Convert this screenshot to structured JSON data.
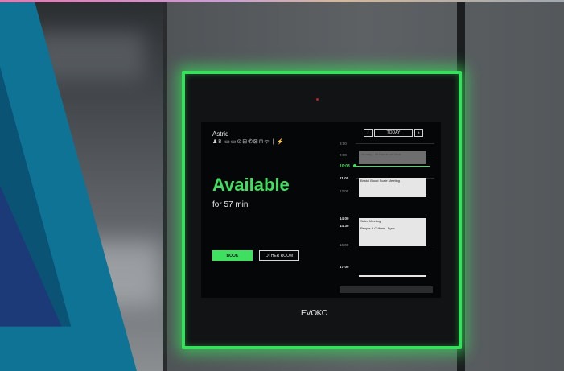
{
  "device": {
    "room_name": "Astrid",
    "facilities": "♟8 ▭▭⊙⊟✆⊠⊓ᯤ | ⚡",
    "status": "Available",
    "duration": "for 57 min",
    "book_label": "BOOK",
    "other_room_label": "OTHER ROOM",
    "brand": "EVOKO",
    "status_color": "#3fe05f",
    "frame_color": "#35e05a"
  },
  "calendar": {
    "prev_icon": "‹",
    "today_label": "TODAY",
    "next_icon": "›",
    "now_time": "10:03",
    "times": [
      "8:00",
      "9:00",
      "11:00",
      "12:00",
      "14:00",
      "14:30",
      "16:00",
      "17:00"
    ],
    "events": [
      {
        "title": "Journey - All Hands on Deck",
        "past": true
      },
      {
        "title": "Bristol Blood Scale Meeting",
        "past": false
      },
      {
        "title": "Sales Meeting",
        "past": false
      },
      {
        "title": "People & Culture - Sync",
        "past": false
      }
    ]
  }
}
